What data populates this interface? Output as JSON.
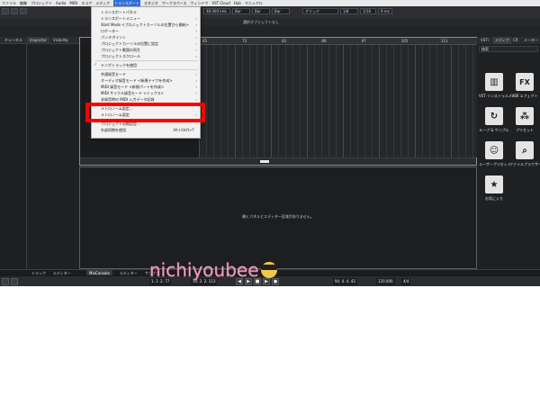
{
  "menubar": {
    "items": [
      "ファイル",
      "編集",
      "プロジェクト",
      "Audio",
      "MIDI",
      "スコア",
      "メディア",
      "トランスポート",
      "スタジオ",
      "ワークスペース",
      "ウィンドウ",
      "VST Cloud",
      "Hub",
      "マニュアル"
    ],
    "active_index": 7
  },
  "toolbar": {
    "grid_label": "グリッド",
    "quantize_value": "1/8",
    "project_title": "選択オブジェクトなし",
    "field_1": "48.000 kHz",
    "field_2": "Bar",
    "field_3": "Bar",
    "field_4": "Bar",
    "field_5": "1/16",
    "field_6": "9 ms"
  },
  "left": {
    "tabs": [
      "チャンネル",
      "Inspector",
      "Visibility"
    ]
  },
  "ruler": {
    "numbers": [
      "65",
      "73",
      "81",
      "89",
      "97",
      "105",
      "113"
    ]
  },
  "lower_zone": {
    "message": "開くパネルとエディター区域がありません。"
  },
  "right": {
    "tabs": [
      "VSTi",
      "メディア",
      "CR",
      "メーター"
    ],
    "search_placeholder": "検索",
    "tiles": [
      {
        "label": "VST インストゥルメント",
        "icon": "piano-keys-icon",
        "glyph": "▥"
      },
      {
        "label": "VST エフェクト",
        "icon": "fx-icon",
        "glyph": "FX"
      },
      {
        "label": "ループ & サンプル",
        "icon": "loop-icon",
        "glyph": "↻"
      },
      {
        "label": "プリセット",
        "icon": "preset-icon",
        "glyph": "⁂"
      },
      {
        "label": "ユーザープリセット",
        "icon": "user-preset-icon",
        "glyph": "☺"
      },
      {
        "label": "ファイルブラウザー",
        "icon": "file-browser-icon",
        "glyph": "⌕"
      },
      {
        "label": "お気に入り",
        "icon": "favorites-icon",
        "glyph": "★"
      }
    ]
  },
  "bottom_tabs": [
    "トラック",
    "エディター",
    "MixConsole",
    "エディター",
    "サンプラ"
  ],
  "transport": {
    "position_1": "1. 2. 2. 77",
    "position_2": "13. 2. 2. 113",
    "position_3": "94. 4. 4. 42",
    "tempo": "120.000",
    "signature": "4/4"
  },
  "dropdown": {
    "items": [
      {
        "label": "トランスポートパネル",
        "kind": "item"
      },
      {
        "label": "トランスポートメニュー",
        "kind": "submenu"
      },
      {
        "label": "Start Mode <プロジェクトカーソルの位置から開始>",
        "kind": "submenu"
      },
      {
        "label": "ロケーター",
        "kind": "submenu"
      },
      {
        "label": "パンチポイント",
        "kind": "submenu"
      },
      {
        "label": "プロジェクトカーソルの位置に設定",
        "kind": "submenu"
      },
      {
        "label": "プロジェクト範囲の再生",
        "kind": "submenu"
      },
      {
        "label": "プロジェクトスクロール",
        "kind": "submenu"
      },
      {
        "label": "テンポトラックを使用",
        "kind": "check"
      },
      {
        "label": "共通録音モード",
        "kind": "submenu"
      },
      {
        "label": "オーディオ録音モード <新規テイクを作成>",
        "kind": "submenu"
      },
      {
        "label": "MIDI 録音モード <新規パートを作成>",
        "kind": "submenu"
      },
      {
        "label": "MIDI サイクル録音モード <ミックス>",
        "kind": "submenu"
      },
      {
        "label": "非録音時の MIDI 入力データ記録",
        "kind": "submenu"
      },
      {
        "label": "メトロノーム設定...",
        "kind": "item"
      },
      {
        "label": "メトロノーム設定",
        "kind": "submenu"
      },
      {
        "label": "プロジェクト同期設定...",
        "kind": "item"
      },
      {
        "label": "外部同期を使用",
        "kind": "shortcut",
        "shortcut": "Alt+Shift+T"
      }
    ]
  },
  "watermark": {
    "text": "nichiyoubee"
  }
}
